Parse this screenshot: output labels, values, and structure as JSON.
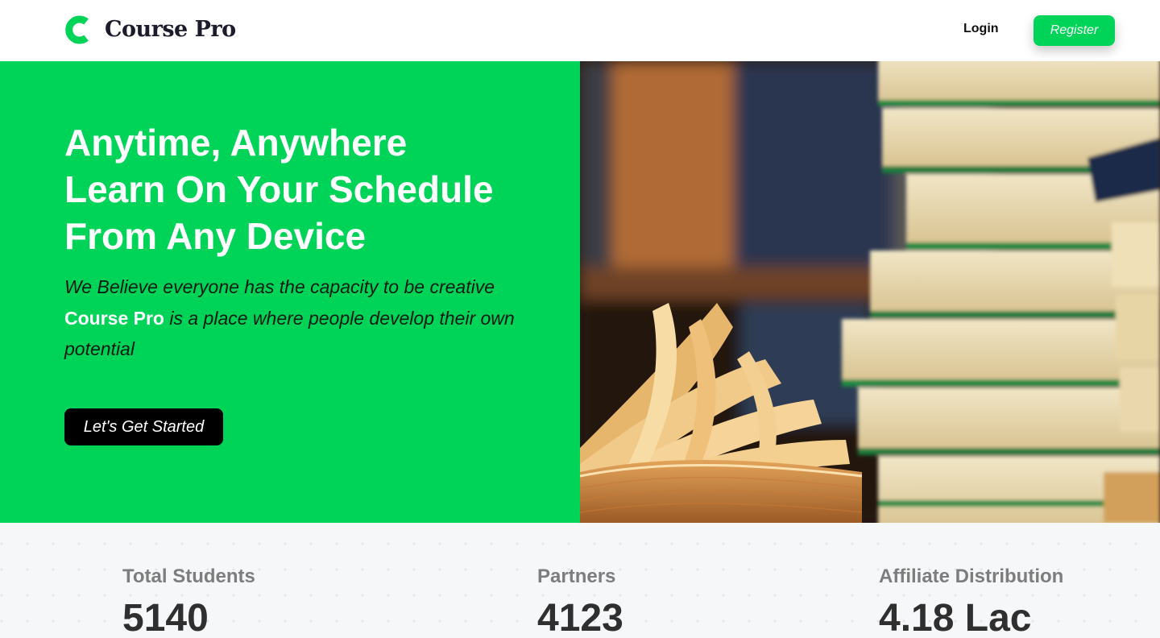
{
  "header": {
    "brand": "Course Pro",
    "logo_icon": "c-logo-icon",
    "login_label": "Login",
    "register_label": "Register"
  },
  "hero": {
    "title_lines": [
      "Anytime, Anywhere",
      "Learn On Your Schedule",
      "From Any Device"
    ],
    "desc_line1": "We Believe everyone has the capacity to be creative",
    "desc_brand": "Course Pro",
    "desc_line2": " is a place where people develop their own potential",
    "cta_label": "Let's Get Started"
  },
  "stats": [
    {
      "label": "Total Students",
      "value": "5140"
    },
    {
      "label": "Partners",
      "value": "4123"
    },
    {
      "label": "Affiliate Distribution",
      "value": "4.18 Lac"
    }
  ],
  "colors": {
    "accent": "#00d458",
    "dark": "#000000",
    "stats_bg": "#f6f7f9",
    "stat_label": "#7d7d7d",
    "stat_value": "#2f2f2f"
  }
}
